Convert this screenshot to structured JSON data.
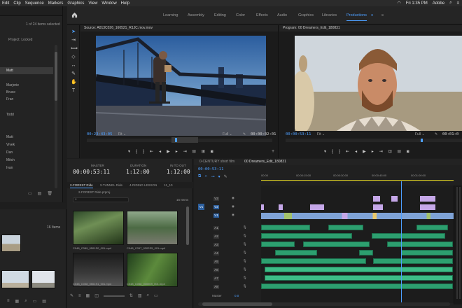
{
  "menubar": {
    "items": [
      "Edit",
      "Clip",
      "Sequence",
      "Markers",
      "Graphics",
      "View",
      "Window",
      "Help"
    ],
    "time": "Fri 1:35 PM",
    "app": "Adobe"
  },
  "left_panel": {
    "count_label": "1 of 24 items selected",
    "locked_label": "Project: Locked",
    "names": [
      "Matt",
      "Marjorie",
      "Bruce",
      "Fran",
      "Todd",
      "Matt",
      "Vivek",
      "Dan",
      "Mitch",
      "Ivan"
    ],
    "items_count": "16 Items"
  },
  "workspaces": {
    "tabs": [
      "Learning",
      "Assembly",
      "Editing",
      "Color",
      "Effects",
      "Audio",
      "Graphics",
      "Libraries",
      "Productions"
    ],
    "active": "Productions",
    "more": "»"
  },
  "source_monitor": {
    "title": "Source: A013C026_160521_R1JC.mov.mov",
    "timecode": "00:23:43:05",
    "fit": "Fit",
    "quality": "Full",
    "duration": "00:00:02:01"
  },
  "program_monitor": {
    "title": "Program: 00 Dreamers_Edit_180831",
    "timecode": "00:00:53:11",
    "fit": "Fit",
    "quality": "Full",
    "duration": "00:01:0"
  },
  "timecode_panel": {
    "master_label": "MASTER",
    "duration_label": "DURATION",
    "in_to_out_label": "IN TO OUT",
    "master": "00:00:53:11",
    "duration": "1:12:00",
    "in_to_out": "1:12:00"
  },
  "bin": {
    "tabs": [
      "2-FOREST Ride",
      "3-TUNNEL Ride",
      "4-RIDING LESSON",
      "11_10"
    ],
    "path": "2-FOREST Ride.prproj",
    "items_count": "16 Items",
    "clips": [
      "C048_C089_0501S0_001.mp4",
      "C048_C057_0302S5_001.mp4",
      "C048_C038_0501S1_001.mp4",
      "C048_C058_030509_001.mp4"
    ]
  },
  "timeline": {
    "tabs": [
      "0-CENTURY short film",
      "00 Dreamers_Edit_180831"
    ],
    "timecode": "00:00:53:11",
    "ruler": [
      "00:00",
      "00:00:15:00",
      "00:00:30:00",
      "00:00:45:00",
      "00:01:00:00"
    ],
    "video_tracks": [
      "V3",
      "V2",
      "V1"
    ],
    "audio_tracks": [
      "A1",
      "A2",
      "A3",
      "A4",
      "A5",
      "A6",
      "A7",
      "A8"
    ],
    "master_label": "Master",
    "master_value": "0.0",
    "v_source": "V1",
    "a_source": "A1"
  }
}
